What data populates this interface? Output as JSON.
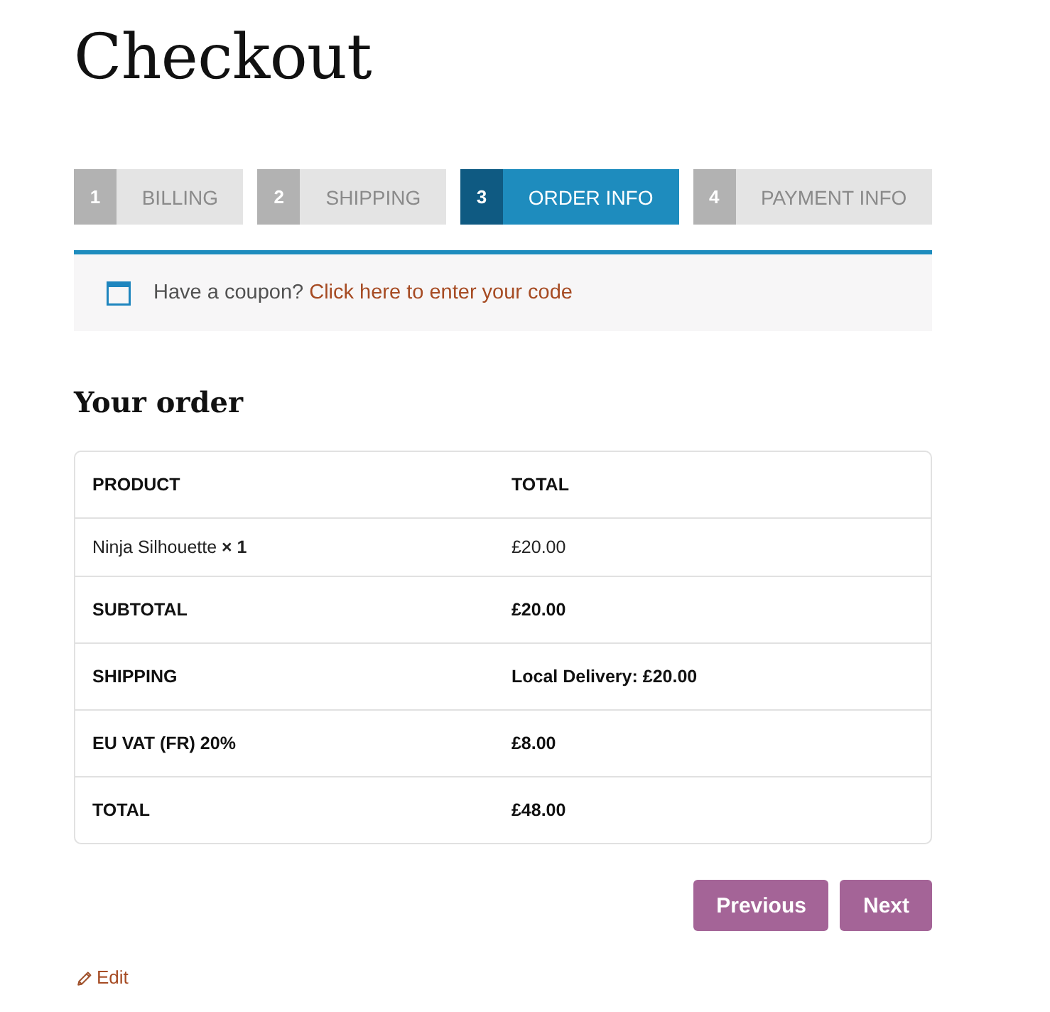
{
  "page": {
    "title": "Checkout"
  },
  "steps": [
    {
      "number": "1",
      "label": "BILLING",
      "selected": false
    },
    {
      "number": "2",
      "label": "SHIPPING",
      "selected": false
    },
    {
      "number": "3",
      "label": "ORDER INFO",
      "selected": true
    },
    {
      "number": "4",
      "label": "PAYMENT INFO",
      "selected": false
    }
  ],
  "coupon": {
    "prompt": "Have a coupon?",
    "link": "Click here to enter your code"
  },
  "order": {
    "heading": "Your order",
    "columns": [
      "PRODUCT",
      "TOTAL"
    ],
    "rows": [
      {
        "kind": "item",
        "product": "Ninja Silhouette **× 1**",
        "total": "£20.00"
      },
      {
        "kind": "summary",
        "label": "SUBTOTAL",
        "value": "£20.00"
      },
      {
        "kind": "summary",
        "label": "SHIPPING",
        "value": "Local Delivery: £20.00"
      },
      {
        "kind": "summary",
        "label": "EU VAT (FR) 20%",
        "value": "£8.00"
      },
      {
        "kind": "summary",
        "label": "TOTAL",
        "value": "£48.00"
      }
    ]
  },
  "buttons": [
    "Previous",
    "Next"
  ],
  "edit_link": "Edit"
}
